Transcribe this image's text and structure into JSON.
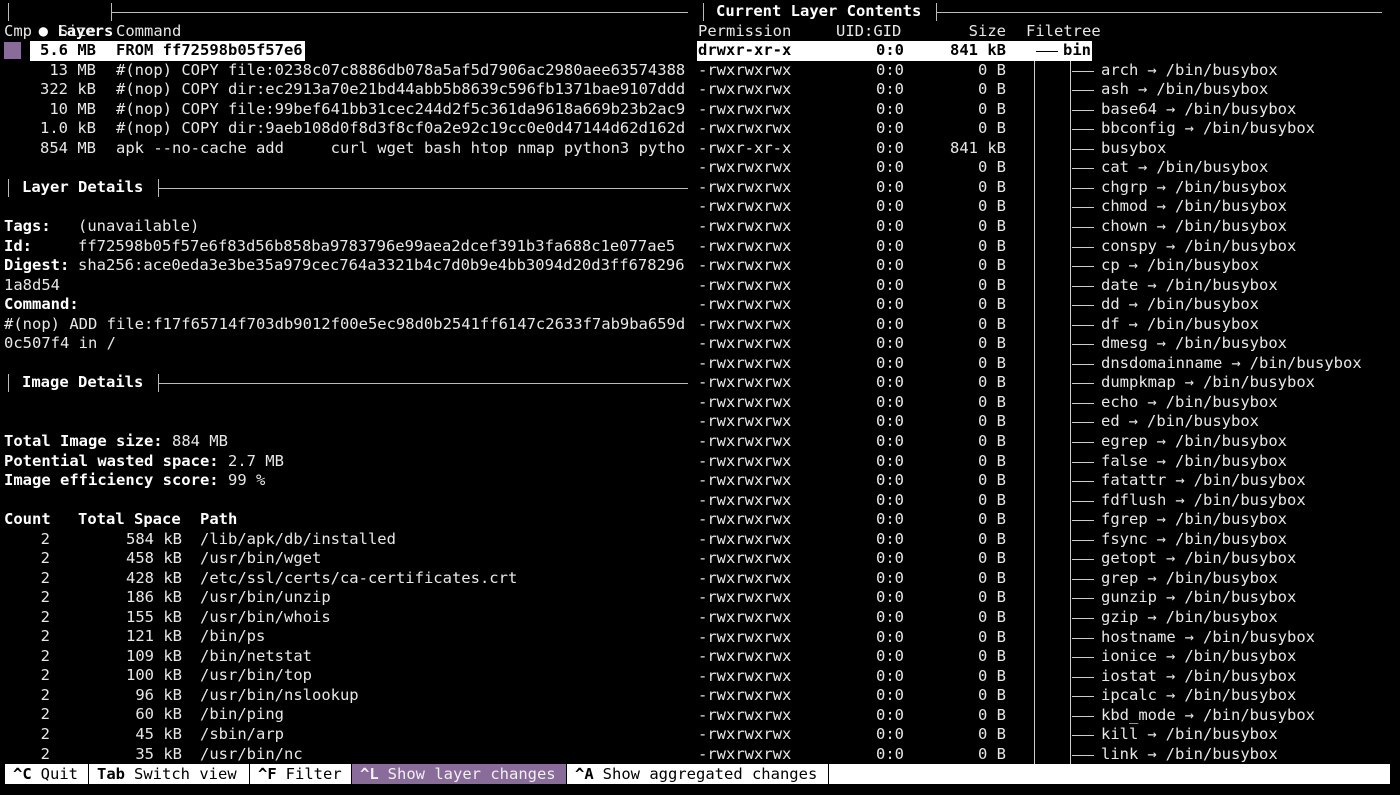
{
  "layers_panel": {
    "title": "Layers",
    "bullet": "●",
    "columns": {
      "cmp": "Cmp",
      "size": "Size",
      "command": "Command"
    },
    "rows": [
      {
        "size": "5.6 MB",
        "command": "FROM ff72598b05f57e6"
      },
      {
        "size": "13 MB",
        "command": "#(nop) COPY file:0238c07c8886db078a5af5d7906ac2980aee63574388"
      },
      {
        "size": "322 kB",
        "command": "#(nop) COPY dir:ec2913a70e21bd44abb5b8639c596fb1371bae9107ddd"
      },
      {
        "size": "10 MB",
        "command": "#(nop) COPY file:99bef641bb31cec244d2f5c361da9618a669b23b2ac9"
      },
      {
        "size": "1.0 kB",
        "command": "#(nop) COPY dir:9aeb108d0f8d3f8cf0a2e92c19cc0e0d47144d62d162d"
      },
      {
        "size": "854 MB",
        "command": "apk --no-cache add     curl wget bash htop nmap python3 pytho"
      }
    ]
  },
  "layer_details": {
    "title": "Layer Details",
    "tags_label": "Tags:",
    "tags_value": "(unavailable)",
    "id_label": "Id:",
    "id_value": "ff72598b05f57e6f83d56b858ba9783796e99aea2dcef391b3fa688c1e077ae5",
    "digest_label": "Digest:",
    "digest_value_1": "sha256:ace0eda3e3be35a979cec764a3321b4c7d0b9e4bb3094d20d3ff678296",
    "digest_value_2": "1a8d54",
    "command_label": "Command:",
    "command_value_1": "#(nop) ADD file:f17f65714f703db9012f00e5ec98d0b2541ff6147c2633f7ab9ba659d",
    "command_value_2": "0c507f4 in /"
  },
  "image_details": {
    "title": "Image Details",
    "total_size_label": "Total Image size:",
    "total_size_value": "884 MB",
    "wasted_label": "Potential wasted space:",
    "wasted_value": "2.7 MB",
    "efficiency_label": "Image efficiency score:",
    "efficiency_value": "99 %",
    "table_headers": {
      "count": "Count",
      "total_space": "Total Space",
      "path": "Path"
    },
    "rows": [
      {
        "count": "2",
        "space": "584 kB",
        "path": "/lib/apk/db/installed"
      },
      {
        "count": "2",
        "space": "458 kB",
        "path": "/usr/bin/wget"
      },
      {
        "count": "2",
        "space": "428 kB",
        "path": "/etc/ssl/certs/ca-certificates.crt"
      },
      {
        "count": "2",
        "space": "186 kB",
        "path": "/usr/bin/unzip"
      },
      {
        "count": "2",
        "space": "155 kB",
        "path": "/usr/bin/whois"
      },
      {
        "count": "2",
        "space": "121 kB",
        "path": "/bin/ps"
      },
      {
        "count": "2",
        "space": "109 kB",
        "path": "/bin/netstat"
      },
      {
        "count": "2",
        "space": "100 kB",
        "path": "/usr/bin/top"
      },
      {
        "count": "2",
        "space": "96 kB",
        "path": "/usr/bin/nslookup"
      },
      {
        "count": "2",
        "space": "60 kB",
        "path": "/bin/ping"
      },
      {
        "count": "2",
        "space": "45 kB",
        "path": "/sbin/arp"
      },
      {
        "count": "2",
        "space": "35 kB",
        "path": "/usr/bin/nc"
      }
    ]
  },
  "contents_panel": {
    "title": "Current Layer Contents",
    "columns": {
      "permission": "Permission",
      "uidgid": "UID:GID",
      "size": "Size",
      "filetree": "Filetree"
    },
    "arrow": "→",
    "rows": [
      {
        "perm": "drwxr-xr-x",
        "uid": "0:0",
        "size": "841 kB",
        "name": "bin",
        "target": ""
      },
      {
        "perm": "-rwxrwxrwx",
        "uid": "0:0",
        "size": "0 B",
        "name": "arch",
        "target": "/bin/busybox"
      },
      {
        "perm": "-rwxrwxrwx",
        "uid": "0:0",
        "size": "0 B",
        "name": "ash",
        "target": "/bin/busybox"
      },
      {
        "perm": "-rwxrwxrwx",
        "uid": "0:0",
        "size": "0 B",
        "name": "base64",
        "target": "/bin/busybox"
      },
      {
        "perm": "-rwxrwxrwx",
        "uid": "0:0",
        "size": "0 B",
        "name": "bbconfig",
        "target": "/bin/busybox"
      },
      {
        "perm": "-rwxr-xr-x",
        "uid": "0:0",
        "size": "841 kB",
        "name": "busybox",
        "target": ""
      },
      {
        "perm": "-rwxrwxrwx",
        "uid": "0:0",
        "size": "0 B",
        "name": "cat",
        "target": "/bin/busybox"
      },
      {
        "perm": "-rwxrwxrwx",
        "uid": "0:0",
        "size": "0 B",
        "name": "chgrp",
        "target": "/bin/busybox"
      },
      {
        "perm": "-rwxrwxrwx",
        "uid": "0:0",
        "size": "0 B",
        "name": "chmod",
        "target": "/bin/busybox"
      },
      {
        "perm": "-rwxrwxrwx",
        "uid": "0:0",
        "size": "0 B",
        "name": "chown",
        "target": "/bin/busybox"
      },
      {
        "perm": "-rwxrwxrwx",
        "uid": "0:0",
        "size": "0 B",
        "name": "conspy",
        "target": "/bin/busybox"
      },
      {
        "perm": "-rwxrwxrwx",
        "uid": "0:0",
        "size": "0 B",
        "name": "cp",
        "target": "/bin/busybox"
      },
      {
        "perm": "-rwxrwxrwx",
        "uid": "0:0",
        "size": "0 B",
        "name": "date",
        "target": "/bin/busybox"
      },
      {
        "perm": "-rwxrwxrwx",
        "uid": "0:0",
        "size": "0 B",
        "name": "dd",
        "target": "/bin/busybox"
      },
      {
        "perm": "-rwxrwxrwx",
        "uid": "0:0",
        "size": "0 B",
        "name": "df",
        "target": "/bin/busybox"
      },
      {
        "perm": "-rwxrwxrwx",
        "uid": "0:0",
        "size": "0 B",
        "name": "dmesg",
        "target": "/bin/busybox"
      },
      {
        "perm": "-rwxrwxrwx",
        "uid": "0:0",
        "size": "0 B",
        "name": "dnsdomainname",
        "target": "/bin/busybox"
      },
      {
        "perm": "-rwxrwxrwx",
        "uid": "0:0",
        "size": "0 B",
        "name": "dumpkmap",
        "target": "/bin/busybox"
      },
      {
        "perm": "-rwxrwxrwx",
        "uid": "0:0",
        "size": "0 B",
        "name": "echo",
        "target": "/bin/busybox"
      },
      {
        "perm": "-rwxrwxrwx",
        "uid": "0:0",
        "size": "0 B",
        "name": "ed",
        "target": "/bin/busybox"
      },
      {
        "perm": "-rwxrwxrwx",
        "uid": "0:0",
        "size": "0 B",
        "name": "egrep",
        "target": "/bin/busybox"
      },
      {
        "perm": "-rwxrwxrwx",
        "uid": "0:0",
        "size": "0 B",
        "name": "false",
        "target": "/bin/busybox"
      },
      {
        "perm": "-rwxrwxrwx",
        "uid": "0:0",
        "size": "0 B",
        "name": "fatattr",
        "target": "/bin/busybox"
      },
      {
        "perm": "-rwxrwxrwx",
        "uid": "0:0",
        "size": "0 B",
        "name": "fdflush",
        "target": "/bin/busybox"
      },
      {
        "perm": "-rwxrwxrwx",
        "uid": "0:0",
        "size": "0 B",
        "name": "fgrep",
        "target": "/bin/busybox"
      },
      {
        "perm": "-rwxrwxrwx",
        "uid": "0:0",
        "size": "0 B",
        "name": "fsync",
        "target": "/bin/busybox"
      },
      {
        "perm": "-rwxrwxrwx",
        "uid": "0:0",
        "size": "0 B",
        "name": "getopt",
        "target": "/bin/busybox"
      },
      {
        "perm": "-rwxrwxrwx",
        "uid": "0:0",
        "size": "0 B",
        "name": "grep",
        "target": "/bin/busybox"
      },
      {
        "perm": "-rwxrwxrwx",
        "uid": "0:0",
        "size": "0 B",
        "name": "gunzip",
        "target": "/bin/busybox"
      },
      {
        "perm": "-rwxrwxrwx",
        "uid": "0:0",
        "size": "0 B",
        "name": "gzip",
        "target": "/bin/busybox"
      },
      {
        "perm": "-rwxrwxrwx",
        "uid": "0:0",
        "size": "0 B",
        "name": "hostname",
        "target": "/bin/busybox"
      },
      {
        "perm": "-rwxrwxrwx",
        "uid": "0:0",
        "size": "0 B",
        "name": "ionice",
        "target": "/bin/busybox"
      },
      {
        "perm": "-rwxrwxrwx",
        "uid": "0:0",
        "size": "0 B",
        "name": "iostat",
        "target": "/bin/busybox"
      },
      {
        "perm": "-rwxrwxrwx",
        "uid": "0:0",
        "size": "0 B",
        "name": "ipcalc",
        "target": "/bin/busybox"
      },
      {
        "perm": "-rwxrwxrwx",
        "uid": "0:0",
        "size": "0 B",
        "name": "kbd_mode",
        "target": "/bin/busybox"
      },
      {
        "perm": "-rwxrwxrwx",
        "uid": "0:0",
        "size": "0 B",
        "name": "kill",
        "target": "/bin/busybox"
      },
      {
        "perm": "-rwxrwxrwx",
        "uid": "0:0",
        "size": "0 B",
        "name": "link",
        "target": "/bin/busybox"
      }
    ]
  },
  "footer": [
    {
      "key": "^C",
      "label": "Quit",
      "active": false
    },
    {
      "key": "Tab",
      "label": "Switch view",
      "active": false
    },
    {
      "key": "^F",
      "label": "Filter",
      "active": false
    },
    {
      "key": "^L",
      "label": "Show layer changes",
      "active": true
    },
    {
      "key": "^A",
      "label": "Show aggregated changes",
      "active": false
    }
  ],
  "colors": {
    "accent": "#8a6c9b",
    "background": "#000000",
    "foreground": "#e8e8e8"
  }
}
